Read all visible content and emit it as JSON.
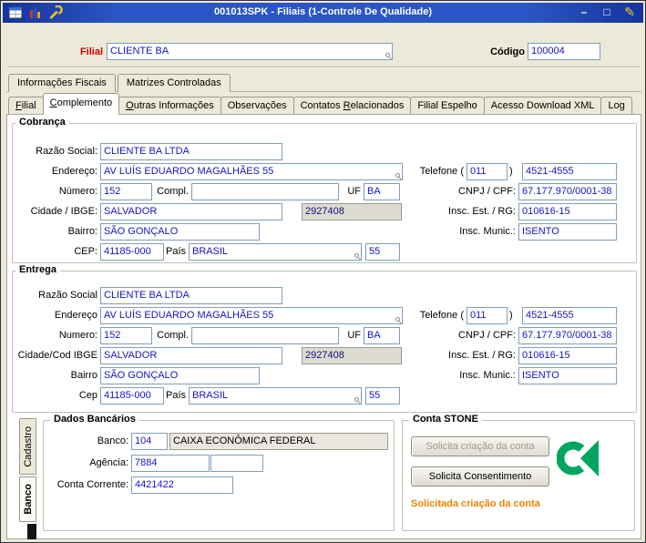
{
  "window": {
    "title": "001013SPK - Filiais (1-Controle De Qualidade)",
    "icons": [
      "form-icon",
      "app-icon",
      "wrench-icon"
    ],
    "controls": [
      "minimize-button",
      "maximize-button",
      "edit-button"
    ]
  },
  "header": {
    "filial_label": "Filial",
    "filial_value": "CLIENTE BA",
    "codigo_label": "Código",
    "codigo_value": "100004"
  },
  "tabs_top": [
    {
      "label": "Informações Fiscais"
    },
    {
      "label": "Matrizes Controladas"
    }
  ],
  "tabs_main": [
    {
      "label": "Filial",
      "accel": "F"
    },
    {
      "label": "Complemento",
      "accel": "C"
    },
    {
      "label": "Outras Informações",
      "accel": "O"
    },
    {
      "label": "Observações",
      "accel": ""
    },
    {
      "label": "Contatos Relacionados",
      "accel": "R"
    },
    {
      "label": "Filial Espelho",
      "accel": ""
    },
    {
      "label": "Acesso Download XML",
      "accel": ""
    },
    {
      "label": "Log",
      "accel": ""
    }
  ],
  "cobranca": {
    "title": "Cobrança",
    "razao_social": {
      "label": "Razão Social:",
      "value": "CLIENTE BA LTDA"
    },
    "endereco": {
      "label": "Endereço:",
      "value": "AV LUÍS EDUARDO MAGALHÃES 55"
    },
    "numero": {
      "label": "Número:",
      "value": "152"
    },
    "compl": {
      "label": "Compl.",
      "value": ""
    },
    "uf": {
      "label": "UF",
      "value": "BA"
    },
    "cidade": {
      "label": "Cidade / IBGE:",
      "value": "SALVADOR"
    },
    "codigo_ibge": "2927408",
    "bairro": {
      "label": "Bairro:",
      "value": "SÃO GONÇALO"
    },
    "cep": {
      "label": "CEP:",
      "value": "41185-000"
    },
    "pais": {
      "label": "País",
      "value": "BRASIL",
      "ddi": "55"
    },
    "telefone": {
      "label_open": "Telefone (",
      "ddd": "011",
      "label_close": ")",
      "numero": "4521-4555"
    },
    "cnpj_cpf": {
      "label": "CNPJ / CPF:",
      "value": "67.177.970/0001-38"
    },
    "insc_est_rg": {
      "label": "Insc. Est. / RG:",
      "value": "010616-15"
    },
    "insc_munic": {
      "label": "Insc. Munic.:",
      "value": "ISENTO"
    }
  },
  "entrega": {
    "title": "Entrega",
    "razao_social": {
      "label": "Razão Social",
      "value": "CLIENTE BA LTDA"
    },
    "endereco": {
      "label": "Endereço",
      "value": "AV LUÍS EDUARDO MAGALHÃES 55"
    },
    "numero": {
      "label": "Numero:",
      "value": "152"
    },
    "compl": {
      "label": "Compl.",
      "value": ""
    },
    "uf": {
      "label": "UF",
      "value": "BA"
    },
    "cidade": {
      "label": "Cidade/Cod IBGE",
      "value": "SALVADOR"
    },
    "codigo_ibge": "2927408",
    "bairro": {
      "label": "Bairro",
      "value": "SÃO GONÇALO"
    },
    "cep": {
      "label": "Cep",
      "value": "41185-000"
    },
    "pais": {
      "label": "País",
      "value": "BRASIL",
      "ddi": "55"
    },
    "telefone": {
      "label_open": "Telefone (",
      "ddd": "011",
      "label_close": ")",
      "numero": "4521-4555"
    },
    "cnpj_cpf": {
      "label": "CNPJ / CPF:",
      "value": "67.177.970/0001-38"
    },
    "insc_est_rg": {
      "label": "Insc. Est. / RG:",
      "value": "010616-15"
    },
    "insc_munic": {
      "label": "Insc. Munic.:",
      "value": "ISENTO"
    }
  },
  "bottom": {
    "side_tabs": [
      {
        "label": "Cadastro"
      },
      {
        "label": "Banco"
      }
    ],
    "dados_bancarios": {
      "title": "Dados Bancários",
      "banco": {
        "label": "Banco:",
        "codigo": "104",
        "nome": "CAIXA ECONÔMICA FEDERAL"
      },
      "agencia": {
        "label": "Agência:",
        "value": "7884",
        "digito": ""
      },
      "conta_corrente": {
        "label": "Conta Corrente:",
        "value": "4421422"
      }
    },
    "conta_stone": {
      "title": "Conta STONE",
      "btn_solicita_criacao": "Solicita criação da conta",
      "btn_solicita_consentimento": "Solicita Consentimento",
      "status": "Solicitada criação da conta",
      "logo_color": "#00a65e"
    }
  }
}
